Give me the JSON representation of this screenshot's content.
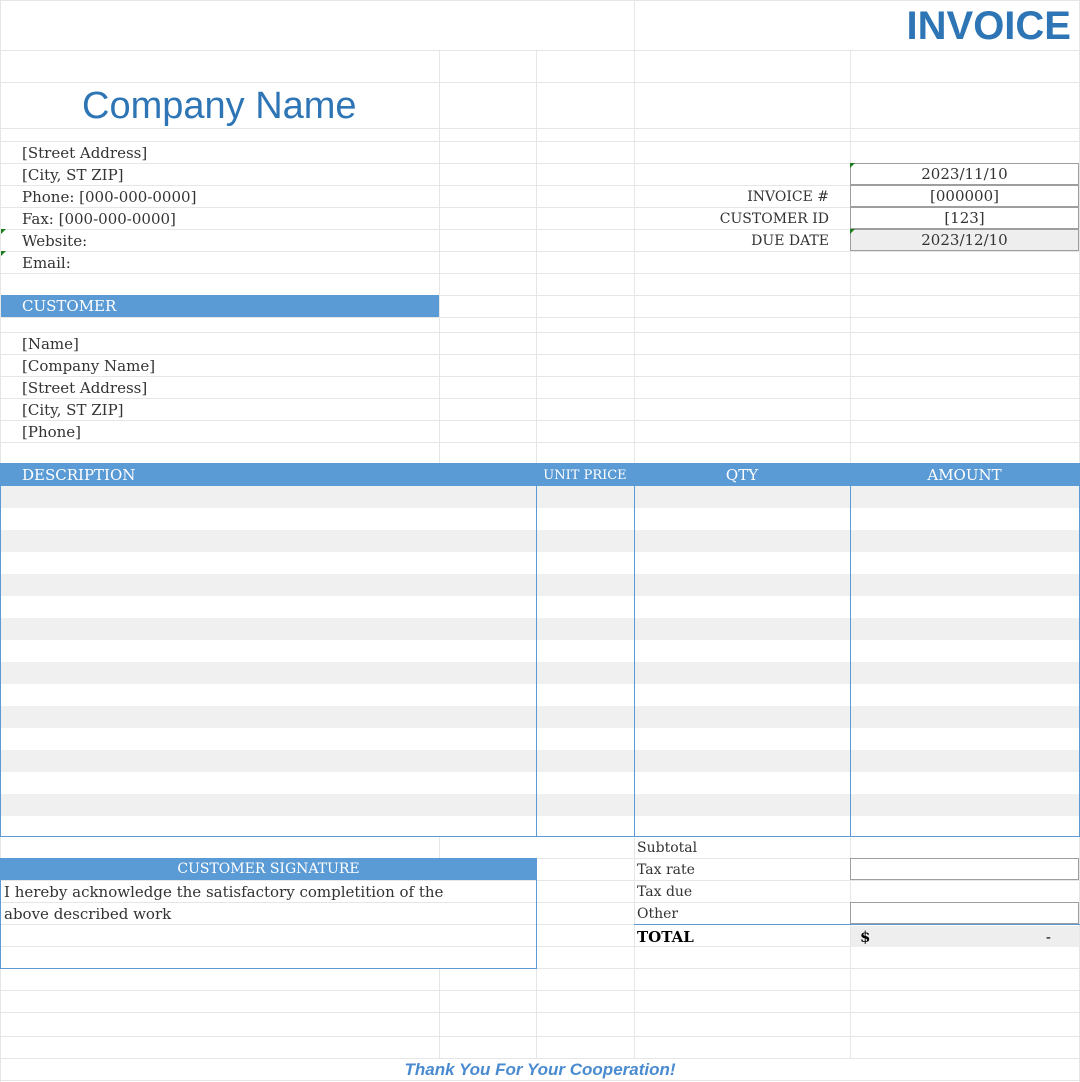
{
  "header": {
    "invoice_title": "INVOICE",
    "company_name": "Company Name"
  },
  "company": {
    "street": "[Street Address]",
    "city": "[City, ST  ZIP]",
    "phone": "Phone: [000-000-0000]",
    "fax": "Fax: [000-000-0000]",
    "website": "Website:",
    "email": "Email:"
  },
  "invoice_meta": {
    "date": "2023/11/10",
    "invoice_label": "INVOICE #",
    "invoice_value": "[000000]",
    "customer_id_label": "CUSTOMER ID",
    "customer_id_value": "[123]",
    "due_date_label": "DUE DATE",
    "due_date_value": "2023/12/10"
  },
  "customer": {
    "section_label": "CUSTOMER",
    "name": "[Name]",
    "company": "[Company Name]",
    "street": "[Street Address]",
    "city": "[City, ST  ZIP]",
    "phone": "[Phone]"
  },
  "table": {
    "headers": {
      "description": "DESCRIPTION",
      "unit_price": "UNIT PRICE",
      "qty": "QTY",
      "amount": "AMOUNT"
    }
  },
  "signature": {
    "label": "CUSTOMER SIGNATURE",
    "line1": "I hereby acknowledge the satisfactory completition of the",
    "line2": "above described work"
  },
  "totals": {
    "subtotal_label": "Subtotal",
    "tax_rate_label": "Tax rate",
    "tax_due_label": "Tax due",
    "other_label": "Other",
    "total_label": "TOTAL",
    "currency_symbol": "$",
    "total_value": "-"
  },
  "footer": {
    "thanks": "Thank You For Your Cooperation!"
  },
  "colors": {
    "accent": "#5b9bd5",
    "title_blue": "#2e75b6",
    "stripe": "#f0f0f0"
  }
}
